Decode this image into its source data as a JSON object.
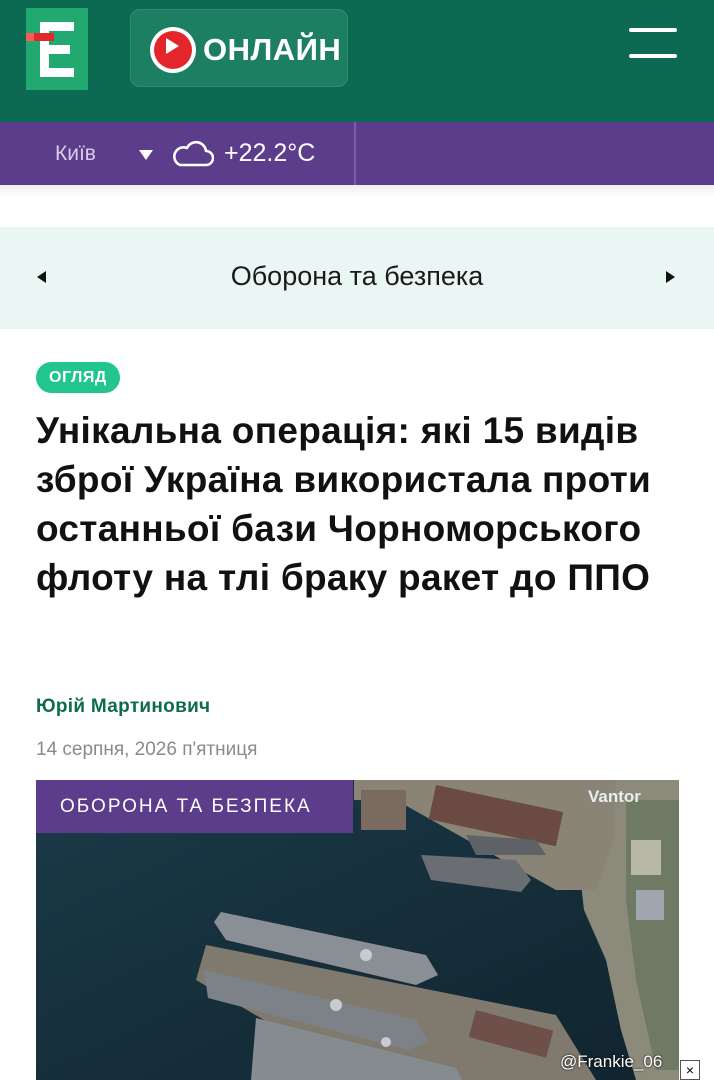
{
  "header": {
    "logo_alt": "Є",
    "online_label": "ОНЛАЙН",
    "colors": {
      "header_bg": "#0d6a52",
      "logo_green": "#22a970",
      "logo_red": "#e3262a"
    }
  },
  "weather": {
    "city": "Київ",
    "temperature": "+22.2°C",
    "icon": "cloud-icon",
    "bar_color": "#5b3d8c"
  },
  "category_nav": {
    "title": "Оборона та безпека"
  },
  "article": {
    "badge": "ОГЛЯД",
    "headline": "Унікальна операція: які 15 видів зброї Україна використала проти останньої бази Чорноморського флоту на тлі браку ракет до ППО",
    "author": "Юрій Мартинович",
    "date": "14 серпня, 2026 п'ятниця",
    "photo": {
      "tag": "ОБОРОНА ТА БЕЗПЕКА",
      "provider": "Vantor"
    }
  },
  "overlay": {
    "watermark": "@Frankie_06",
    "close": "×"
  }
}
